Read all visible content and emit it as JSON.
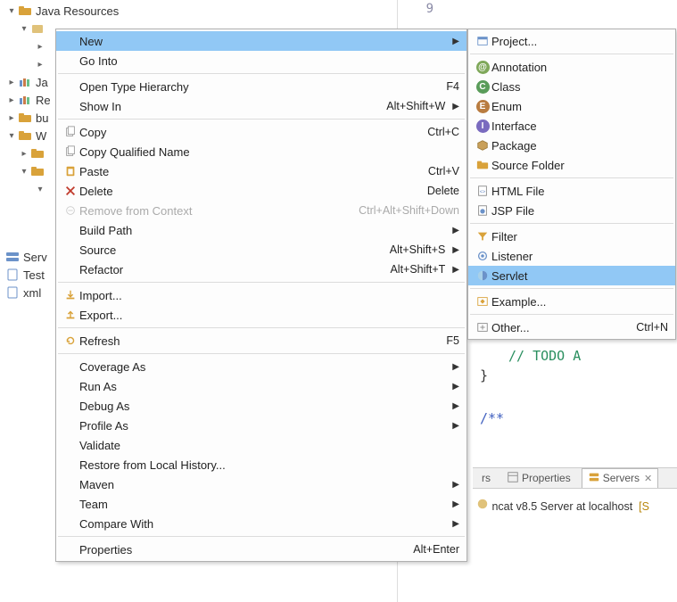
{
  "tree": {
    "node0": "Java Resources",
    "node_ja": "Ja",
    "node_re": "Re",
    "node_bu": "bu",
    "node_w": "W",
    "node_serv": "Serv",
    "node_test": "Test",
    "node_xml": "xml"
  },
  "editor": {
    "line": "9",
    "todo": "// TODO  A",
    "brace": "}",
    "javadoc": "/**"
  },
  "ctx": {
    "new": "New",
    "go_into": "Go Into",
    "open_type_hierarchy": "Open Type Hierarchy",
    "show_in": "Show In",
    "copy": "Copy",
    "copy_qn": "Copy Qualified Name",
    "paste": "Paste",
    "delete": "Delete",
    "remove_ctx": "Remove from Context",
    "build_path": "Build Path",
    "source": "Source",
    "refactor": "Refactor",
    "import": "Import...",
    "export": "Export...",
    "refresh": "Refresh",
    "coverage_as": "Coverage As",
    "run_as": "Run As",
    "debug_as": "Debug As",
    "profile_as": "Profile As",
    "validate": "Validate",
    "restore_lh": "Restore from Local History...",
    "maven": "Maven",
    "team": "Team",
    "compare_with": "Compare With",
    "properties": "Properties"
  },
  "accel": {
    "f4": "F4",
    "show_in": "Alt+Shift+W",
    "ctrl_c": "Ctrl+C",
    "ctrl_v": "Ctrl+V",
    "delete": "Delete",
    "remove_ctx": "Ctrl+Alt+Shift+Down",
    "source": "Alt+Shift+S",
    "refactor": "Alt+Shift+T",
    "f5": "F5",
    "alt_enter": "Alt+Enter",
    "ctrl_n": "Ctrl+N"
  },
  "sub": {
    "project": "Project...",
    "annotation": "Annotation",
    "class": "Class",
    "enum": "Enum",
    "interface": "Interface",
    "package": "Package",
    "source_folder": "Source Folder",
    "html_file": "HTML File",
    "jsp_file": "JSP File",
    "filter": "Filter",
    "listener": "Listener",
    "servlet": "Servlet",
    "example": "Example...",
    "other": "Other..."
  },
  "tabs": {
    "rs": "rs",
    "properties": "Properties",
    "servers": "Servers"
  },
  "server": {
    "name": "ncat v8.5 Server at localhost",
    "status": "[S"
  }
}
